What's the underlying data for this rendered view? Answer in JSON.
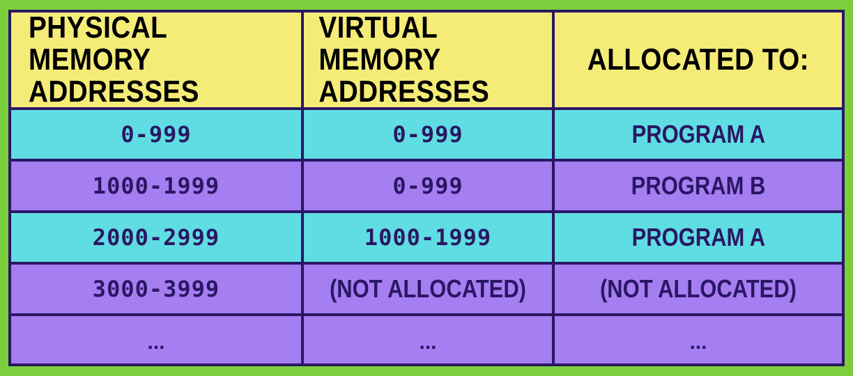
{
  "table": {
    "headers": [
      "PHYSICAL MEMORY ADDRESSES",
      "VIRTUAL MEMORY ADDRESSES",
      "ALLOCATED TO:"
    ],
    "header_lines": [
      [
        "PHYSICAL MEMORY",
        "ADDRESSES"
      ],
      [
        "VIRTUAL MEMORY",
        "ADDRESSES"
      ],
      [
        "ALLOCATED TO:"
      ]
    ],
    "rows": [
      [
        "0-999",
        "0-999",
        "PROGRAM A"
      ],
      [
        "1000-1999",
        "0-999",
        "PROGRAM B"
      ],
      [
        "2000-2999",
        "1000-1999",
        "PROGRAM A"
      ],
      [
        "3000-3999",
        "(NOT ALLOCATED)",
        "(NOT ALLOCATED)"
      ],
      [
        "...",
        "...",
        "..."
      ]
    ],
    "colors": {
      "background": "#7ccf3c",
      "border": "#2a1764",
      "header": "#f5ec78",
      "row_cyan": "#5fdde2",
      "row_purple": "#a57ef1",
      "text": "#2a1764"
    }
  }
}
